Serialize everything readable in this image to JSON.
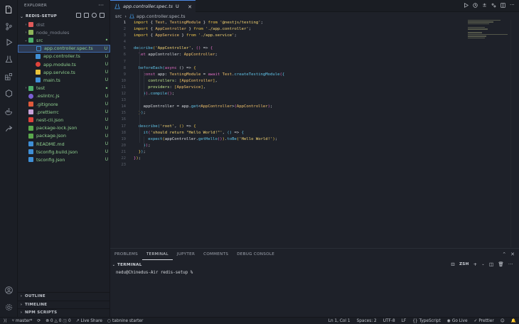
{
  "sidebar": {
    "title": "EXPLORER",
    "project": "REDIS-SETUP",
    "items": [
      {
        "label": "dist",
        "kind": "folder",
        "icon_color": "#e05a5a",
        "text_color": "#7f8591",
        "badge": "",
        "depth": 1
      },
      {
        "label": "node_modules",
        "kind": "folder",
        "icon_color": "#8fb55a",
        "text_color": "#7f8591",
        "badge": "",
        "depth": 1
      },
      {
        "label": "src",
        "kind": "folder-open",
        "icon_color": "#4caf6a",
        "text_color": "#8fcf8f",
        "badge": "•",
        "depth": 1
      },
      {
        "label": "app.controller.spec.ts",
        "kind": "test",
        "icon_color": "#3f8fd6",
        "text_color": "#8fcf8f",
        "badge": "U",
        "depth": 2,
        "selected": true
      },
      {
        "label": "app.controller.ts",
        "kind": "ts",
        "icon_color": "#3f8fd6",
        "text_color": "#8fcf8f",
        "badge": "U",
        "depth": 2
      },
      {
        "label": "app.module.ts",
        "kind": "module",
        "icon_color": "#e0433b",
        "text_color": "#8fcf8f",
        "badge": "U",
        "depth": 2
      },
      {
        "label": "app.service.ts",
        "kind": "service",
        "icon_color": "#e8c23a",
        "text_color": "#8fcf8f",
        "badge": "U",
        "depth": 2
      },
      {
        "label": "main.ts",
        "kind": "ts",
        "icon_color": "#3f8fd6",
        "text_color": "#8fcf8f",
        "badge": "U",
        "depth": 2
      },
      {
        "label": "test",
        "kind": "folder",
        "icon_color": "#4caf6a",
        "text_color": "#8fcf8f",
        "badge": "•",
        "depth": 1
      },
      {
        "label": ".eslintrc.js",
        "kind": "eslint",
        "icon_color": "#7b5fd4",
        "text_color": "#8fcf8f",
        "badge": "U",
        "depth": 1
      },
      {
        "label": ".gitignore",
        "kind": "git",
        "icon_color": "#e05a3b",
        "text_color": "#8fcf8f",
        "badge": "U",
        "depth": 1
      },
      {
        "label": ".prettierrc",
        "kind": "prettier",
        "icon_color": "#c7a2d8",
        "text_color": "#8fcf8f",
        "badge": "U",
        "depth": 1
      },
      {
        "label": "nest-cli.json",
        "kind": "json",
        "icon_color": "#e0433b",
        "text_color": "#8fcf8f",
        "badge": "U",
        "depth": 1
      },
      {
        "label": "package-lock.json",
        "kind": "json",
        "icon_color": "#5aa84c",
        "text_color": "#8fcf8f",
        "badge": "U",
        "depth": 1
      },
      {
        "label": "package.json",
        "kind": "json",
        "icon_color": "#5aa84c",
        "text_color": "#8fcf8f",
        "badge": "U",
        "depth": 1
      },
      {
        "label": "README.md",
        "kind": "md",
        "icon_color": "#3f8fd6",
        "text_color": "#8fcf8f",
        "badge": "U",
        "depth": 1
      },
      {
        "label": "tsconfig.build.json",
        "kind": "tsconfig",
        "icon_color": "#3f8fd6",
        "text_color": "#8fcf8f",
        "badge": "U",
        "depth": 1
      },
      {
        "label": "tsconfig.json",
        "kind": "tsconfig",
        "icon_color": "#3f8fd6",
        "text_color": "#8fcf8f",
        "badge": "U",
        "depth": 1
      }
    ],
    "sections": [
      "OUTLINE",
      "TIMELINE",
      "NPM SCRIPTS"
    ]
  },
  "editor": {
    "tab_label": "app.controller.spec.ts",
    "tab_status": "U",
    "breadcrumb": [
      "src",
      "app.controller.spec.ts"
    ],
    "current_line": 1,
    "lines": [
      [
        [
          "kw",
          "import"
        ],
        [
          "pun",
          " { "
        ],
        [
          "cls",
          "Test"
        ],
        [
          "pun",
          ", "
        ],
        [
          "cls",
          "TestingModule"
        ],
        [
          "pun",
          " } "
        ],
        [
          "kw",
          "from"
        ],
        [
          "str",
          " '@nestjs/testing'"
        ],
        [
          "pun",
          ";"
        ]
      ],
      [
        [
          "kw",
          "import"
        ],
        [
          "pun",
          " { "
        ],
        [
          "cls",
          "AppController"
        ],
        [
          "pun",
          " } "
        ],
        [
          "kw",
          "from"
        ],
        [
          "str",
          " './app.controller'"
        ],
        [
          "pun",
          ";"
        ]
      ],
      [
        [
          "kw",
          "import"
        ],
        [
          "pun",
          " { "
        ],
        [
          "cls",
          "AppService"
        ],
        [
          "pun",
          " } "
        ],
        [
          "kw",
          "from"
        ],
        [
          "str",
          " './app.service'"
        ],
        [
          "pun",
          ";"
        ]
      ],
      [],
      [
        [
          "fn",
          "describe"
        ],
        [
          "br1",
          "("
        ],
        [
          "str",
          "'AppController'"
        ],
        [
          "pun",
          ", "
        ],
        [
          "br2",
          "()"
        ],
        [
          "pun",
          " => "
        ],
        [
          "br2",
          "{"
        ]
      ],
      [
        [
          "kw2",
          "  let "
        ],
        [
          "var",
          "appController"
        ],
        [
          "pun",
          ": "
        ],
        [
          "cls",
          "AppController"
        ],
        [
          "pun",
          ";"
        ]
      ],
      [],
      [
        [
          "fn",
          "  beforeEach"
        ],
        [
          "br3",
          "("
        ],
        [
          "kw2",
          "async"
        ],
        [
          "pun",
          " () => "
        ],
        [
          "br1",
          "{"
        ]
      ],
      [
        [
          "kw2",
          "    const "
        ],
        [
          "var",
          "app"
        ],
        [
          "pun",
          ": "
        ],
        [
          "cls",
          "TestingModule"
        ],
        [
          "pun",
          " = "
        ],
        [
          "kw2",
          "await "
        ],
        [
          "cls",
          "Test"
        ],
        [
          "pun",
          "."
        ],
        [
          "fn",
          "createTestingModule"
        ],
        [
          "br2",
          "("
        ],
        [
          "br3",
          "{"
        ]
      ],
      [
        [
          "prop",
          "      controllers"
        ],
        [
          "pun",
          ": "
        ],
        [
          "br1",
          "["
        ],
        [
          "cls",
          "AppController"
        ],
        [
          "br1",
          "]"
        ],
        [
          "pun",
          ","
        ]
      ],
      [
        [
          "prop",
          "      providers"
        ],
        [
          "pun",
          ": "
        ],
        [
          "br1",
          "["
        ],
        [
          "cls",
          "AppService"
        ],
        [
          "br1",
          "]"
        ],
        [
          "pun",
          ","
        ]
      ],
      [
        [
          "br3",
          "    }"
        ],
        [
          "br2",
          ")"
        ],
        [
          "pun",
          "."
        ],
        [
          "fn",
          "compile"
        ],
        [
          "br2",
          "()"
        ],
        [
          "pun",
          ";"
        ]
      ],
      [],
      [
        [
          "var",
          "    appController"
        ],
        [
          "pun",
          " = "
        ],
        [
          "var",
          "app"
        ],
        [
          "pun",
          "."
        ],
        [
          "fn",
          "get"
        ],
        [
          "pun",
          "<"
        ],
        [
          "cls",
          "AppController"
        ],
        [
          "pun",
          ">"
        ],
        [
          "br2",
          "("
        ],
        [
          "cls",
          "AppController"
        ],
        [
          "br2",
          ")"
        ],
        [
          "pun",
          ";"
        ]
      ],
      [
        [
          "br1",
          "  }"
        ],
        [
          "br3",
          ")"
        ],
        [
          "pun",
          ";"
        ]
      ],
      [],
      [
        [
          "fn",
          "  describe"
        ],
        [
          "br3",
          "("
        ],
        [
          "str",
          "'root'"
        ],
        [
          "pun",
          ", "
        ],
        [
          "br1",
          "()"
        ],
        [
          "pun",
          " => "
        ],
        [
          "br1",
          "{"
        ]
      ],
      [
        [
          "fn",
          "    it"
        ],
        [
          "br2",
          "("
        ],
        [
          "str",
          "'should return \"Hello World!\"'"
        ],
        [
          "pun",
          ", "
        ],
        [
          "br3",
          "()"
        ],
        [
          "pun",
          " => "
        ],
        [
          "br3",
          "{"
        ]
      ],
      [
        [
          "fn",
          "      expect"
        ],
        [
          "br1",
          "("
        ],
        [
          "var",
          "appController"
        ],
        [
          "pun",
          "."
        ],
        [
          "fn",
          "getHello"
        ],
        [
          "br2",
          "()"
        ],
        [
          "br1",
          ")"
        ],
        [
          "pun",
          "."
        ],
        [
          "fn",
          "toBe"
        ],
        [
          "br1",
          "("
        ],
        [
          "str",
          "'Hello World!'"
        ],
        [
          "br1",
          ")"
        ],
        [
          "pun",
          ";"
        ]
      ],
      [
        [
          "br3",
          "    }"
        ],
        [
          "br2",
          ")"
        ],
        [
          "pun",
          ";"
        ]
      ],
      [
        [
          "br1",
          "  }"
        ],
        [
          "br3",
          ")"
        ],
        [
          "pun",
          ";"
        ]
      ],
      [
        [
          "br2",
          "}"
        ],
        [
          "br1",
          ")"
        ],
        [
          "pun",
          ";"
        ]
      ],
      []
    ]
  },
  "panel": {
    "tabs": [
      "PROBLEMS",
      "TERMINAL",
      "JUPYTER",
      "COMMENTS",
      "DEBUG CONSOLE"
    ],
    "active_tab": "TERMINAL",
    "terminal_title": "TERMINAL",
    "shell": "zsh",
    "prompt": "nedu@Chinedus-Air redis-setup %"
  },
  "status": {
    "branch": "master*",
    "errors": "0",
    "warnings": "0",
    "info": "0",
    "live_share": "Live Share",
    "tabnine": "tabnine starter",
    "position": "Ln 1, Col 1",
    "spaces": "Spaces: 2",
    "encoding": "UTF-8",
    "eol": "LF",
    "language": "TypeScript",
    "go_live": "Go Live",
    "prettier": "Prettier"
  },
  "colors": {
    "accent": "#4d8ae6",
    "untracked_green": "#8fcf8f",
    "background": "#1e2129"
  }
}
